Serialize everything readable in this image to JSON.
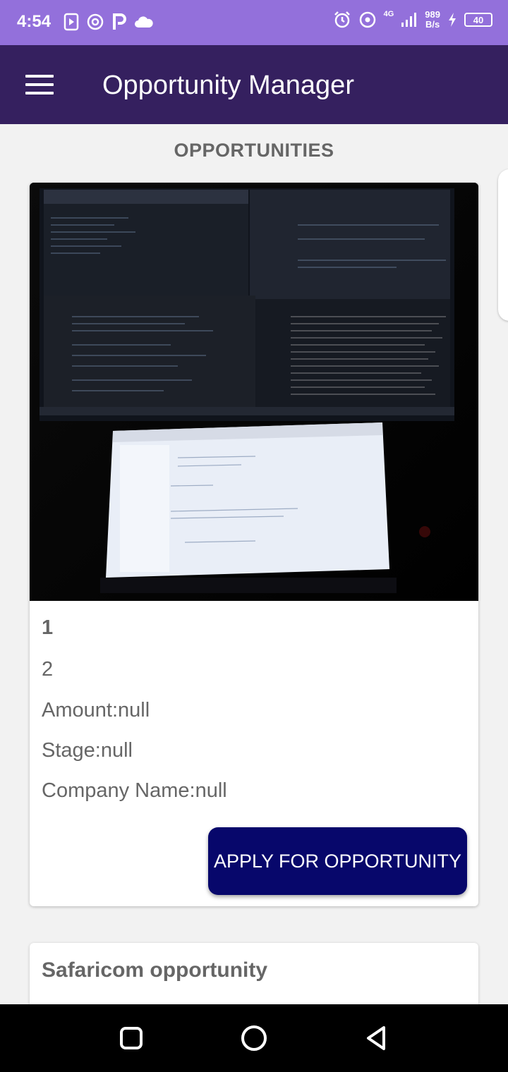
{
  "status_bar": {
    "time": "4:54",
    "network_gen": "4G",
    "net_speed_value": "989",
    "net_speed_unit": "B/s",
    "battery": "40",
    "background_color": "#9370DB"
  },
  "app_bar": {
    "title": "Opportunity Manager",
    "background_color": "#35205F",
    "menu_icon": "hamburger-menu-icon"
  },
  "section_title": "OPPORTUNITIES",
  "opportunities": [
    {
      "title": "1",
      "subtitle": "2",
      "amount": "Amount:null",
      "stage": "Stage:null",
      "company": "Company Name:null",
      "apply_label": "APPLY FOR OPPORTUNITY",
      "image": "photo of a computer monitor showing an IDE and a laptop screen"
    },
    {
      "title": "Safaricom opportunity"
    }
  ],
  "accent_color": "#07076B",
  "nav_bar": {
    "icons": [
      "recents-square-icon",
      "home-circle-icon",
      "back-triangle-icon"
    ]
  }
}
